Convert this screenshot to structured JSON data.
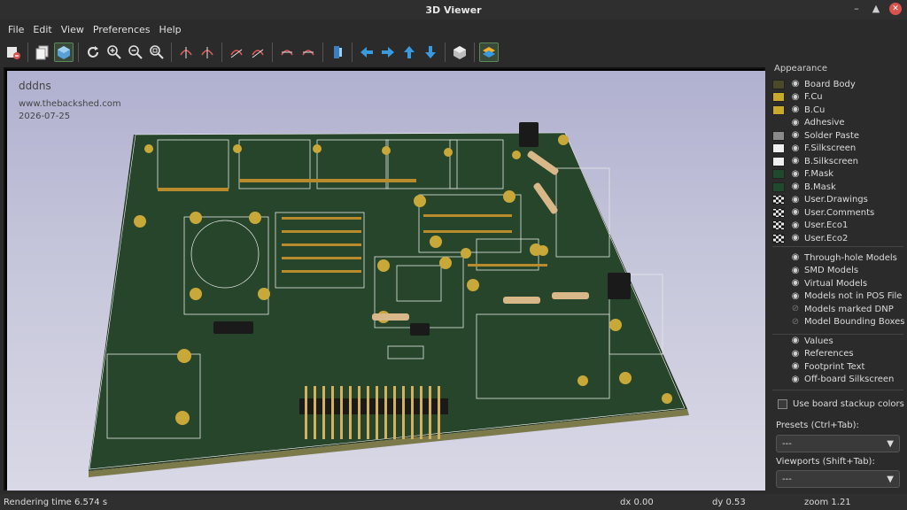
{
  "window": {
    "title": "3D Viewer"
  },
  "menu": [
    "File",
    "Edit",
    "View",
    "Preferences",
    "Help"
  ],
  "toolbar": {
    "icons": [
      "export-image-icon",
      "copy-icon",
      "raytrace-toggle-icon",
      "reload-icon",
      "zoom-in-icon",
      "zoom-out-icon",
      "zoom-fit-icon",
      "rotate-x-cw-icon",
      "rotate-x-ccw-icon",
      "rotate-y-cw-icon",
      "rotate-y-ccw-icon",
      "rotate-z-cw-icon",
      "rotate-z-ccw-icon",
      "flip-board-icon",
      "pan-left-icon",
      "pan-right-icon",
      "pan-up-icon",
      "pan-down-icon",
      "orthographic-icon",
      "layers-toggle-icon"
    ]
  },
  "viewport": {
    "overlay_title": "dddns",
    "overlay_url": "www.thebackshed.com",
    "overlay_date": "2026-07-25"
  },
  "appearance": {
    "title": "Appearance",
    "layers": [
      {
        "label": "Board Body",
        "color": "#4a4a2a",
        "visible": true
      },
      {
        "label": "F.Cu",
        "color": "#c8a92a",
        "visible": true
      },
      {
        "label": "B.Cu",
        "color": "#c8a92a",
        "visible": true
      },
      {
        "label": "Adhesive",
        "color": "",
        "visible": true
      },
      {
        "label": "Solder Paste",
        "color": "#8a8a8a",
        "visible": true
      },
      {
        "label": "F.Silkscreen",
        "color": "#f0f0f0",
        "visible": true
      },
      {
        "label": "B.Silkscreen",
        "color": "#f0f0f0",
        "visible": true
      },
      {
        "label": "F.Mask",
        "color": "#1f4a2e",
        "visible": true
      },
      {
        "label": "B.Mask",
        "color": "#1f4a2e",
        "visible": true
      },
      {
        "label": "User.Drawings",
        "color": "checker",
        "visible": true
      },
      {
        "label": "User.Comments",
        "color": "checker",
        "visible": true
      },
      {
        "label": "User.Eco1",
        "color": "checker",
        "visible": true
      },
      {
        "label": "User.Eco2",
        "color": "checker",
        "visible": true
      }
    ],
    "models": [
      {
        "label": "Through-hole Models",
        "visible": true
      },
      {
        "label": "SMD Models",
        "visible": true
      },
      {
        "label": "Virtual Models",
        "visible": true
      },
      {
        "label": "Models not in POS File",
        "visible": true
      },
      {
        "label": "Models marked DNP",
        "visible": false
      },
      {
        "label": "Model Bounding Boxes",
        "visible": false
      }
    ],
    "text_items": [
      {
        "label": "Values",
        "visible": true
      },
      {
        "label": "References",
        "visible": true
      },
      {
        "label": "Footprint Text",
        "visible": true
      },
      {
        "label": "Off-board Silkscreen",
        "visible": true
      }
    ],
    "stackup_checkbox": "Use board stackup colors",
    "presets_label": "Presets (Ctrl+Tab):",
    "presets_value": "---",
    "viewports_label": "Viewports (Shift+Tab):",
    "viewports_value": "---"
  },
  "status": {
    "render_time": "Rendering time 6.574 s",
    "dx": "dx 0.00",
    "dy": "dy 0.53",
    "zoom": "zoom 1.21"
  }
}
